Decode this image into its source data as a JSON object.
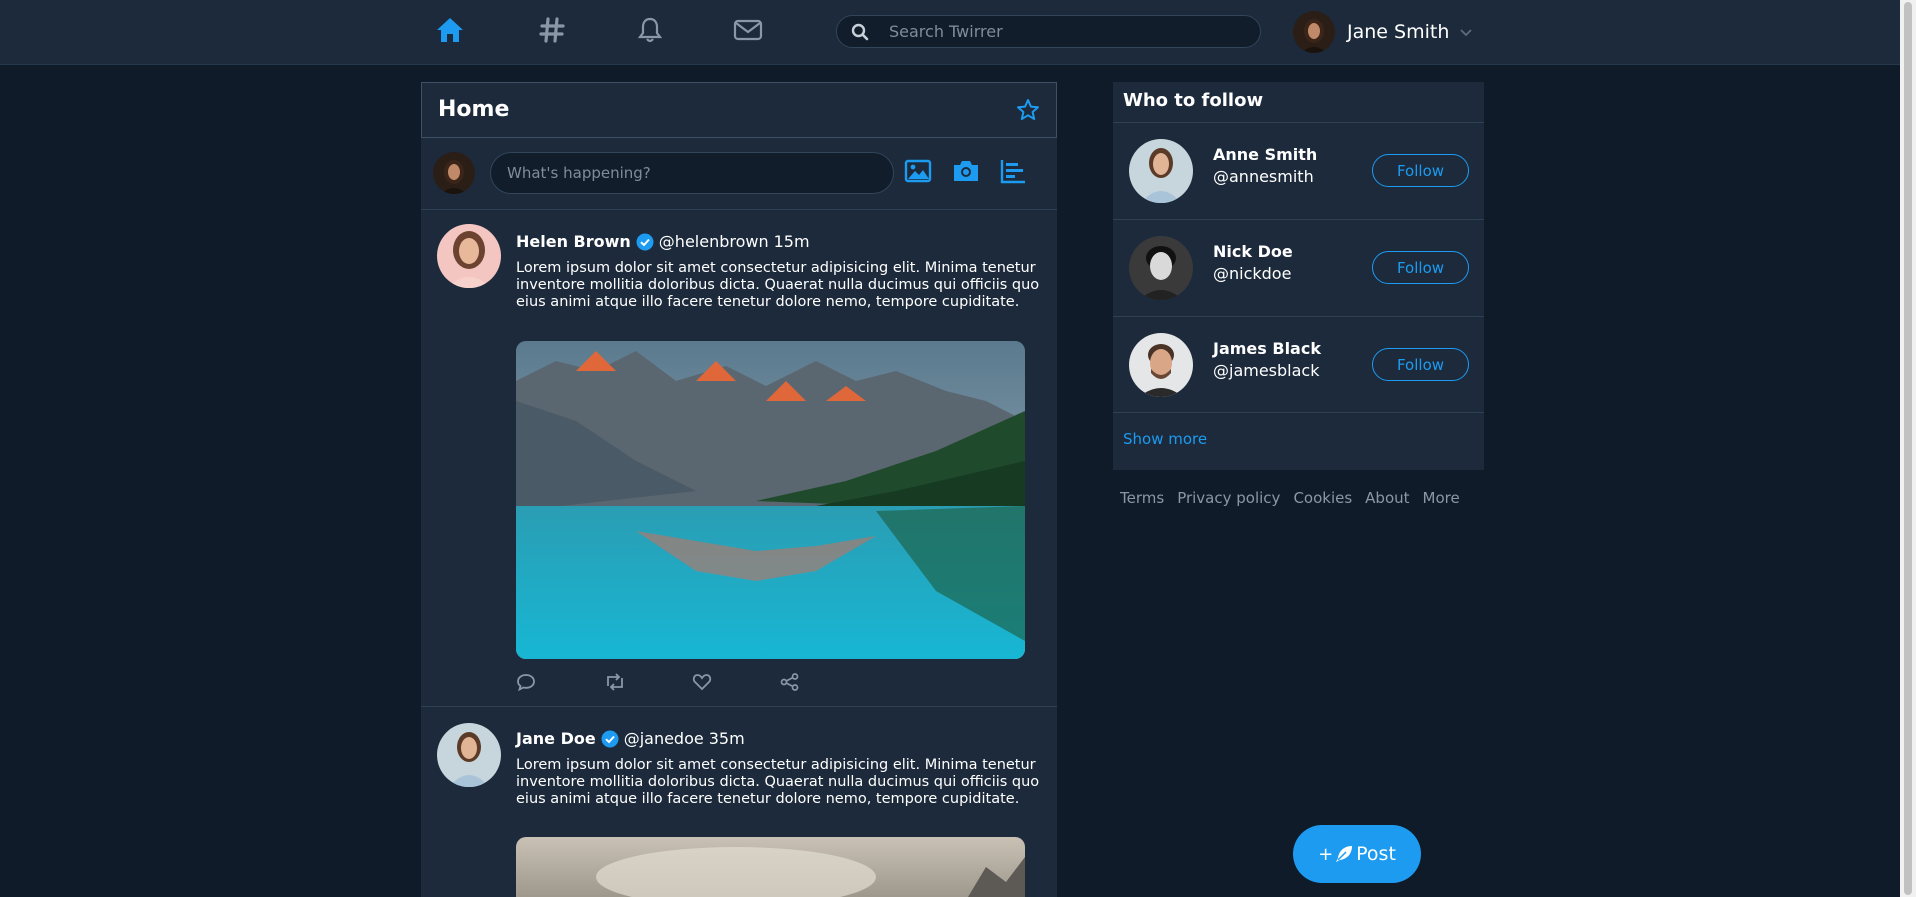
{
  "nav": {
    "icons": [
      "home-icon",
      "hashtag-icon",
      "bell-icon",
      "envelope-icon"
    ],
    "search_placeholder": "Search Twirrer",
    "user_name": "Jane Smith"
  },
  "main": {
    "title": "Home",
    "composer_placeholder": "What's happening?"
  },
  "tweets": [
    {
      "author": "Helen Brown",
      "handle": "@helenbrown",
      "time": "15m",
      "text": "Lorem ipsum dolor sit amet consectetur adipisicing elit. Minima tenetur inventore mollitia doloribus dicta. Quaerat nulla ducimus qui officiis quo eius animi atque illo facere tenetur dolore nemo, tempore cupiditate."
    },
    {
      "author": "Jane Doe",
      "handle": "@janedoe",
      "time": "35m",
      "text": "Lorem ipsum dolor sit amet consectetur adipisicing elit. Minima tenetur inventore mollitia doloribus dicta. Quaerat nulla ducimus qui officiis quo eius animi atque illo facere tenetur dolore nemo, tempore cupiditate."
    }
  ],
  "who_to_follow": {
    "title": "Who to follow",
    "users": [
      {
        "name": "Anne Smith",
        "handle": "@annesmith",
        "button": "Follow"
      },
      {
        "name": "Nick Doe",
        "handle": "@nickdoe",
        "button": "Follow"
      },
      {
        "name": "James Black",
        "handle": "@jamesblack",
        "button": "Follow"
      }
    ],
    "show_more": "Show more"
  },
  "footer_links": [
    "Terms",
    "Privacy policy",
    "Cookies",
    "About",
    "More"
  ],
  "post_button": "Post",
  "colors": {
    "accent": "#1d9bf0",
    "page_bg": "#0f1b28",
    "panel_bg": "#1c2a3b"
  }
}
